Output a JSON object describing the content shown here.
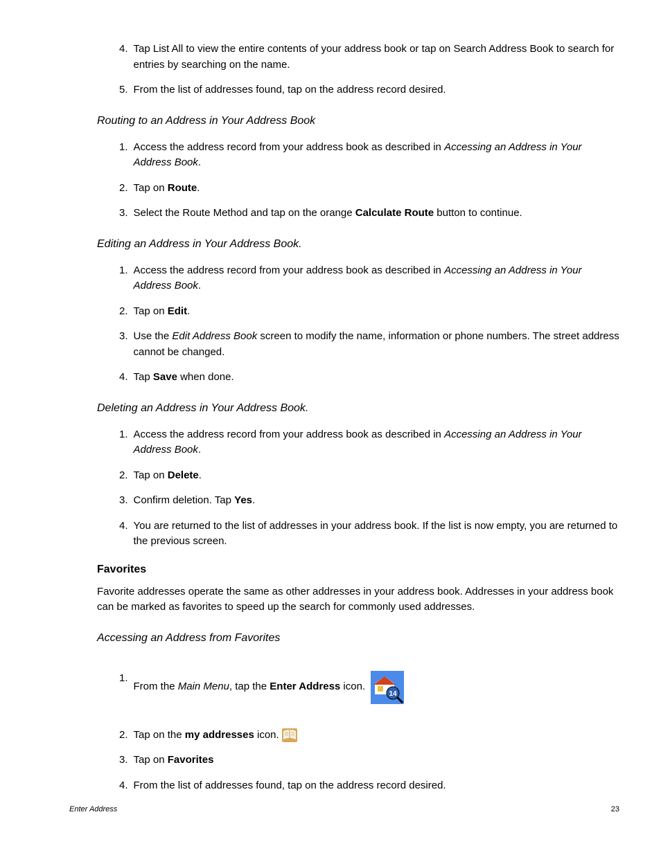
{
  "top_list": {
    "item4_num": "4.",
    "item4_text": "Tap List All to view the entire contents of your address book or tap on Search Address Book to search for entries by searching on the name.",
    "item5_num": "5.",
    "item5_text": "From the list of addresses found, tap on the address record desired."
  },
  "routing": {
    "heading": "Routing to an Address in Your Address Book",
    "item1_num": "1.",
    "item1_prefix": "Access the address record from your address book as described in ",
    "item1_italic": "Accessing an Address in Your Address Book",
    "item1_suffix": ".",
    "item2_num": "2.",
    "item2_prefix": "Tap on ",
    "item2_bold": "Route",
    "item2_suffix": ".",
    "item3_num": "3.",
    "item3_prefix": "Select the Route Method and tap on the orange ",
    "item3_bold": "Calculate Route",
    "item3_suffix": " button to continue."
  },
  "editing": {
    "heading": "Editing an Address in Your Address Book.",
    "item1_num": "1.",
    "item1_prefix": "Access the address record from your address book as described in ",
    "item1_italic": "Accessing an Address in Your Address Book",
    "item1_suffix": ".",
    "item2_num": "2.",
    "item2_prefix": "Tap on ",
    "item2_bold": "Edit",
    "item2_suffix": ".",
    "item3_num": "3.",
    "item3_prefix": "Use the ",
    "item3_italic": "Edit Address Book",
    "item3_suffix": " screen to modify the name, information or phone numbers.  The street address cannot be changed.",
    "item4_num": "4.",
    "item4_prefix": "Tap ",
    "item4_bold": "Save",
    "item4_suffix": " when done."
  },
  "deleting": {
    "heading": "Deleting an Address in Your Address Book.",
    "item1_num": "1.",
    "item1_prefix": "Access the address record from your address book as described in ",
    "item1_italic": "Accessing an Address in Your Address Book",
    "item1_suffix": ".",
    "item2_num": "2.",
    "item2_prefix": "Tap on ",
    "item2_bold": "Delete",
    "item2_suffix": ".",
    "item3_num": "3.",
    "item3_prefix": "Confirm deletion.  Tap ",
    "item3_bold": "Yes",
    "item3_suffix": ".",
    "item4_num": "4.",
    "item4_text": "You are returned to the list of addresses in your address book.  If the list is now empty, you are returned to the previous screen."
  },
  "favorites": {
    "heading": "Favorites",
    "para": "Favorite addresses operate the same as other addresses in your address book.  Addresses in your address book can be marked as favorites to speed up the search for commonly used addresses."
  },
  "accessing_fav": {
    "heading": "Accessing an Address from Favorites",
    "item1_num": "1.",
    "item1_prefix": "From the ",
    "item1_italic": "Main Menu",
    "item1_mid": ", tap the ",
    "item1_bold": "Enter Address",
    "item1_suffix": " icon.",
    "item2_num": "2.",
    "item2_prefix": "Tap on the ",
    "item2_bold": "my addresses",
    "item2_suffix": " icon.",
    "item3_num": "3.",
    "item3_prefix": "Tap on ",
    "item3_bold": "Favorites",
    "item4_num": "4.",
    "item4_text": "From the list of addresses found, tap on the address record desired."
  },
  "footer": {
    "left": "Enter Address",
    "right": "23"
  },
  "icons": {
    "enter_address": "enter-address-icon",
    "my_addresses": "my-addresses-icon"
  }
}
